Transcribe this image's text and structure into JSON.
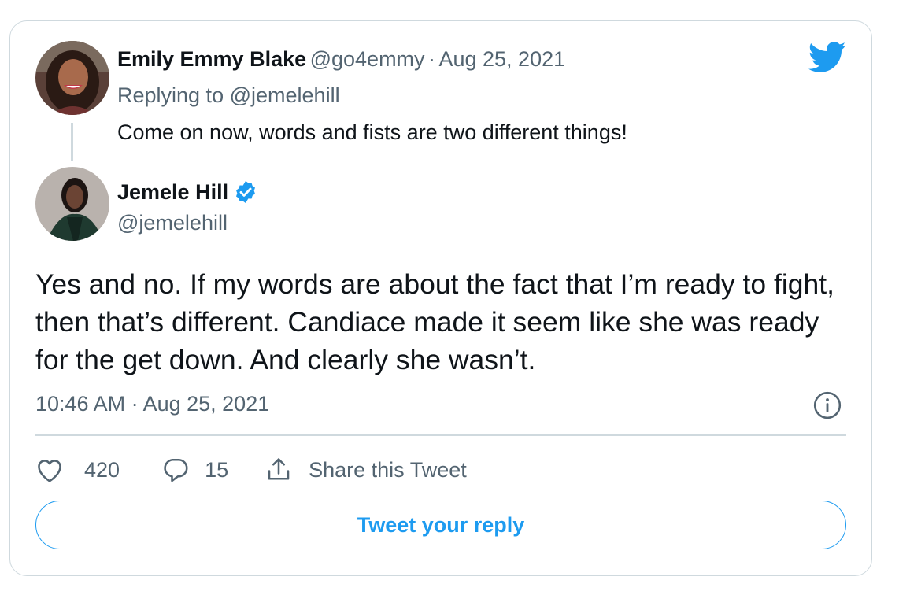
{
  "quoted_reply": {
    "author_name": "Emily Emmy Blake",
    "author_handle": "@go4emmy",
    "separator": "·",
    "date": "Aug 25, 2021",
    "replying_prefix": "Replying to",
    "replying_handle": "@jemelehill",
    "text": "Come on now, words and fists are two different things!"
  },
  "tweet": {
    "author_name": "Jemele Hill",
    "author_handle": "@jemelehill",
    "verified": true,
    "text": "Yes and no. If my words are about the fact that I’m ready to fight, then that’s different. Candiace made it seem like she was ready for the get down. And clearly she wasn’t.",
    "timestamp": "10:46 AM · Aug 25, 2021"
  },
  "actions": {
    "likes": "420",
    "replies": "15",
    "share_label": "Share this Tweet"
  },
  "reply_button_label": "Tweet your reply",
  "icons": [
    "twitter-logo-icon",
    "verified-badge-icon",
    "info-icon",
    "heart-icon",
    "reply-bubble-icon",
    "share-icon"
  ],
  "colors": {
    "accent": "#1d9bf0",
    "muted_text": "#536471",
    "border": "#cfd9de",
    "text": "#0f1419"
  }
}
